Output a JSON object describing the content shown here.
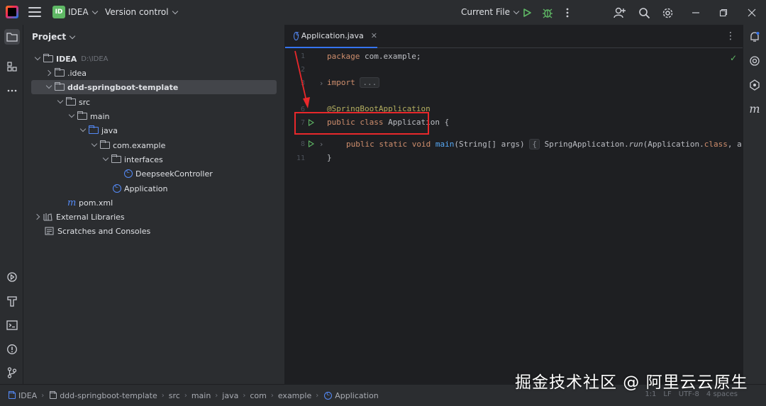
{
  "titlebar": {
    "project_badge": "ID",
    "project_name": "IDEA",
    "vcs_label": "Version control",
    "run_config": "Current File"
  },
  "project_panel": {
    "title": "Project",
    "tree": [
      {
        "label": "IDEA",
        "path": "D:\\IDEA"
      },
      {
        "label": ".idea"
      },
      {
        "label": "ddd-springboot-template"
      },
      {
        "label": "src"
      },
      {
        "label": "main"
      },
      {
        "label": "java"
      },
      {
        "label": "com.example"
      },
      {
        "label": "interfaces"
      },
      {
        "label": "DeepseekController"
      },
      {
        "label": "Application"
      },
      {
        "label": "pom.xml"
      },
      {
        "label": "External Libraries"
      },
      {
        "label": "Scratches and Consoles"
      }
    ]
  },
  "editor": {
    "tab_label": "Application.java",
    "line_numbers": [
      "1",
      "2",
      "3",
      "6",
      "7",
      "8",
      "11"
    ],
    "code": {
      "l1_kw": "package",
      "l1_rest": " com.example;",
      "l3_kw": "import",
      "l3_fold": "...",
      "l6_ann": "@SpringBootApplication",
      "l7_kw": "public class",
      "l7_rest": " Application {",
      "l8_kw": "public static void",
      "l8_fn": "main",
      "l8_args": "(String[] args)",
      "l8_open": "{",
      "l8_body_a": "SpringApplication.",
      "l8_body_run": "run",
      "l8_body_b": "(Application.",
      "l8_body_kw": "class",
      "l8_body_c": ", a",
      "l11": "}"
    }
  },
  "statusbar": {
    "breadcrumb": [
      "IDEA",
      "ddd-springboot-template",
      "src",
      "main",
      "java",
      "com",
      "example",
      "Application"
    ],
    "position": "1:1",
    "line_sep": "LF",
    "encoding": "UTF-8",
    "indent": "4 spaces"
  },
  "watermark": "掘金技术社区 @ 阿里云云原生",
  "colors": {
    "accent": "#3574f0",
    "run_green": "#5fb865",
    "highlight_red": "#e8282b"
  }
}
